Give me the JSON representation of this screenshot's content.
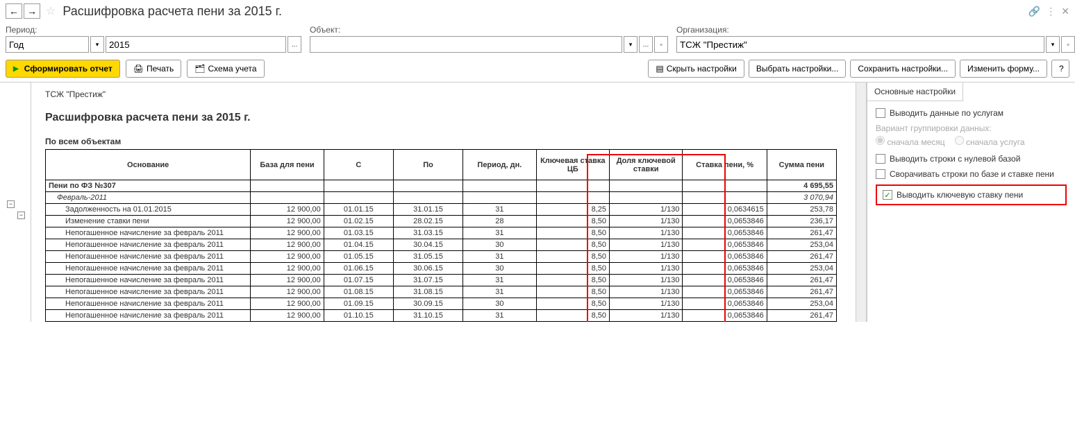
{
  "header": {
    "title": "Расшифровка расчета пени  за 2015 г."
  },
  "filters": {
    "period_label": "Период:",
    "period_type": "Год",
    "period_year": "2015",
    "object_label": "Объект:",
    "object_value": "",
    "org_label": "Организация:",
    "org_value": "ТСЖ \"Престиж\""
  },
  "toolbar": {
    "form_report": "Сформировать отчет",
    "print": "Печать",
    "scheme": "Схема учета",
    "hide_settings": "Скрыть настройки",
    "choose_settings": "Выбрать настройки...",
    "save_settings": "Сохранить настройки...",
    "change_form": "Изменить форму...",
    "help": "?"
  },
  "report": {
    "org": "ТСЖ \"Престиж\"",
    "title": "Расшифровка расчета пени за 2015 г.",
    "subtitle": "По всем объектам",
    "columns": {
      "basis": "Основание",
      "base": "База для пени",
      "from": "С",
      "to": "По",
      "period": "Период, дн.",
      "key_rate": "Ключевая ставка ЦБ",
      "share": "Доля ключевой ставки",
      "rate_pct": "Ставка пени, %",
      "sum": "Сумма пени"
    },
    "rows": [
      {
        "type": "bold",
        "basis": "Пени по ФЗ №307",
        "base": "",
        "from": "",
        "to": "",
        "period": "",
        "key_rate": "",
        "share": "",
        "rate_pct": "",
        "sum": "4 695,55"
      },
      {
        "type": "italic",
        "indent": 1,
        "basis": "Февраль-2011",
        "base": "",
        "from": "",
        "to": "",
        "period": "",
        "key_rate": "",
        "share": "",
        "rate_pct": "",
        "sum": "3 070,94"
      },
      {
        "indent": 2,
        "basis": "Задолженность на 01.01.2015",
        "base": "12 900,00",
        "from": "01.01.15",
        "to": "31.01.15",
        "period": "31",
        "key_rate": "8,25",
        "share": "1/130",
        "rate_pct": "0,0634615",
        "sum": "253,78"
      },
      {
        "indent": 2,
        "basis": "Изменение ставки пени",
        "base": "12 900,00",
        "from": "01.02.15",
        "to": "28.02.15",
        "period": "28",
        "key_rate": "8,50",
        "share": "1/130",
        "rate_pct": "0,0653846",
        "sum": "236,17"
      },
      {
        "indent": 2,
        "basis": "Непогашенное начисление за февраль 2011",
        "base": "12 900,00",
        "from": "01.03.15",
        "to": "31.03.15",
        "period": "31",
        "key_rate": "8,50",
        "share": "1/130",
        "rate_pct": "0,0653846",
        "sum": "261,47"
      },
      {
        "indent": 2,
        "basis": "Непогашенное начисление за февраль 2011",
        "base": "12 900,00",
        "from": "01.04.15",
        "to": "30.04.15",
        "period": "30",
        "key_rate": "8,50",
        "share": "1/130",
        "rate_pct": "0,0653846",
        "sum": "253,04"
      },
      {
        "indent": 2,
        "basis": "Непогашенное начисление за февраль 2011",
        "base": "12 900,00",
        "from": "01.05.15",
        "to": "31.05.15",
        "period": "31",
        "key_rate": "8,50",
        "share": "1/130",
        "rate_pct": "0,0653846",
        "sum": "261,47"
      },
      {
        "indent": 2,
        "basis": "Непогашенное начисление за февраль 2011",
        "base": "12 900,00",
        "from": "01.06.15",
        "to": "30.06.15",
        "period": "30",
        "key_rate": "8,50",
        "share": "1/130",
        "rate_pct": "0,0653846",
        "sum": "253,04"
      },
      {
        "indent": 2,
        "basis": "Непогашенное начисление за февраль 2011",
        "base": "12 900,00",
        "from": "01.07.15",
        "to": "31.07.15",
        "period": "31",
        "key_rate": "8,50",
        "share": "1/130",
        "rate_pct": "0,0653846",
        "sum": "261,47"
      },
      {
        "indent": 2,
        "basis": "Непогашенное начисление за февраль 2011",
        "base": "12 900,00",
        "from": "01.08.15",
        "to": "31.08.15",
        "period": "31",
        "key_rate": "8,50",
        "share": "1/130",
        "rate_pct": "0,0653846",
        "sum": "261,47"
      },
      {
        "indent": 2,
        "basis": "Непогашенное начисление за февраль 2011",
        "base": "12 900,00",
        "from": "01.09.15",
        "to": "30.09.15",
        "period": "30",
        "key_rate": "8,50",
        "share": "1/130",
        "rate_pct": "0,0653846",
        "sum": "253,04"
      },
      {
        "indent": 2,
        "basis": "Непогашенное начисление за февраль 2011",
        "base": "12 900,00",
        "from": "01.10.15",
        "to": "31.10.15",
        "period": "31",
        "key_rate": "8,50",
        "share": "1/130",
        "rate_pct": "0,0653846",
        "sum": "261,47"
      }
    ]
  },
  "settings": {
    "tab": "Основные настройки",
    "opt_services": "Выводить данные по услугам",
    "group_label": "Вариант группировки данных:",
    "radio_month": "сначала месяц",
    "radio_service": "сначала услуга",
    "opt_zero": "Выводить строки с нулевой базой",
    "opt_collapse": "Сворачивать строки по базе и ставке пени",
    "opt_keyrate": "Выводить ключевую ставку пени"
  }
}
